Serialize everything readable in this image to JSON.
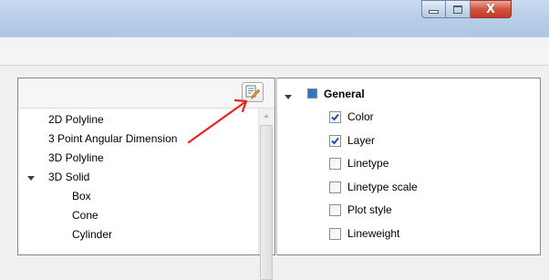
{
  "window": {
    "caption_buttons": [
      {
        "icon": "minimize-icon"
      },
      {
        "icon": "maximize-icon"
      },
      {
        "icon": "close-icon",
        "glyph": "X"
      }
    ]
  },
  "left_panel": {
    "header_button_icon": "edit-list-icon",
    "items": [
      {
        "label": "2D Polyline",
        "level": 0,
        "expanded": false
      },
      {
        "label": "3 Point Angular Dimension",
        "level": 0,
        "expanded": false
      },
      {
        "label": "3D Polyline",
        "level": 0,
        "expanded": false
      },
      {
        "label": "3D Solid",
        "level": 0,
        "expanded": true
      },
      {
        "label": "Box",
        "level": 1,
        "expanded": false
      },
      {
        "label": "Cone",
        "level": 1,
        "expanded": false
      },
      {
        "label": "Cylinder",
        "level": 1,
        "expanded": false
      }
    ]
  },
  "right_panel": {
    "group": {
      "label": "General",
      "expanded": true,
      "icon_color": "#2f77c0"
    },
    "properties": [
      {
        "label": "Color",
        "checked": true
      },
      {
        "label": "Layer",
        "checked": true
      },
      {
        "label": "Linetype",
        "checked": false
      },
      {
        "label": "Linetype scale",
        "checked": false
      },
      {
        "label": "Plot style",
        "checked": false
      },
      {
        "label": "Lineweight",
        "checked": false
      }
    ]
  },
  "annotation": {
    "color": "#e8231c"
  }
}
